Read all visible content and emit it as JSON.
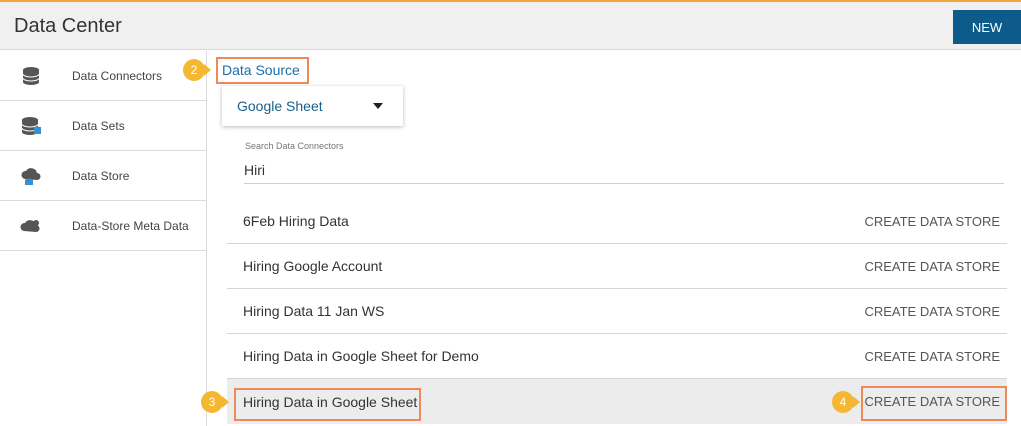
{
  "header": {
    "title": "Data Center",
    "new_label": "NEW"
  },
  "sidebar": {
    "items": [
      {
        "label": "Data Connectors",
        "icon": "database-icon"
      },
      {
        "label": "Data Sets",
        "icon": "dataset-icon"
      },
      {
        "label": "Data Store",
        "icon": "cloud-store-icon"
      },
      {
        "label": "Data-Store Meta Data",
        "icon": "cloud-meta-icon"
      }
    ]
  },
  "main": {
    "section_title": "Data Source",
    "source_select": {
      "value": "Google Sheet"
    },
    "search": {
      "label": "Search Data Connectors",
      "value": "Hiri"
    },
    "rows": [
      {
        "name": "6Feb Hiring Data",
        "action": "CREATE DATA STORE"
      },
      {
        "name": "Hiring Google Account",
        "action": "CREATE DATA STORE"
      },
      {
        "name": "Hiring Data 11 Jan WS",
        "action": "CREATE DATA STORE"
      },
      {
        "name": "Hiring Data in Google Sheet for Demo",
        "action": "CREATE DATA STORE"
      },
      {
        "name": "Hiring Data in Google Sheet",
        "action": "CREATE DATA STORE"
      }
    ]
  },
  "annotations": {
    "step2": "2",
    "step3": "3",
    "step4": "4"
  },
  "colors": {
    "accent": "#0d5b8a",
    "badge": "#f4b731",
    "highlight": "#ee8a5a",
    "top_line": "#f0a63c"
  }
}
